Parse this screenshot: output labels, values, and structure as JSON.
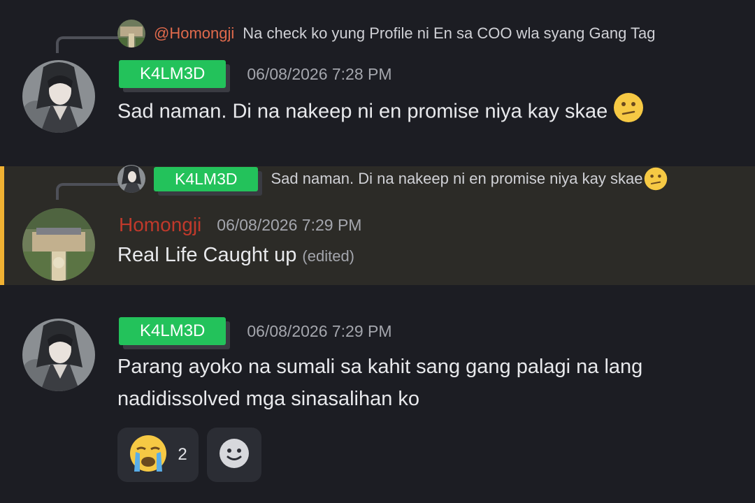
{
  "messages": [
    {
      "reply": {
        "mention": "@Homongji",
        "text": "Na check ko yung Profile ni En sa COO wla syang Gang Tag"
      },
      "author": "K4LM3D",
      "timestamp": "06/08/2026 7:28 PM",
      "content": "Sad naman. Di na nakeep ni en promise niya kay skae"
    },
    {
      "reply": {
        "tag": "K4LM3D",
        "text": "Sad naman. Di na nakeep ni en promise niya kay skae"
      },
      "author": "Homongji",
      "timestamp": "06/08/2026 7:29 PM",
      "content": "Real Life Caught up",
      "edited": "(edited)"
    },
    {
      "author": "K4LM3D",
      "timestamp": "06/08/2026 7:29 PM",
      "content_line1": "Parang ayoko na sumali sa kahit sang gang palagi na lang",
      "content_line2": "nadidissolved mga sinasalihan ko"
    }
  ],
  "reactions": [
    {
      "emoji": "crying-face",
      "count": "2"
    },
    {
      "emoji": "add-reaction-icon"
    }
  ],
  "colors": {
    "background": "#1c1d23",
    "tag_green": "#23c25b",
    "mention_red": "#e06a4c",
    "homongji_red": "#c0392b",
    "highlight_bar": "#f0b132"
  }
}
